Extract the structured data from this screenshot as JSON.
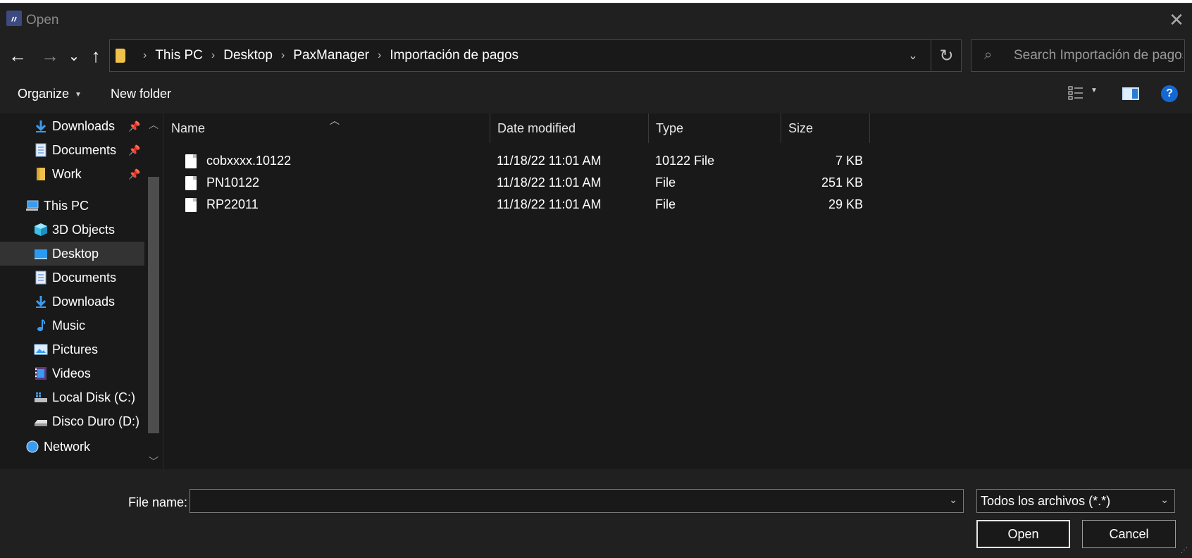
{
  "window": {
    "title": "Open",
    "close_glyph": "✕"
  },
  "nav_buttons": {
    "back": "←",
    "forward": "→",
    "recent": "⌄",
    "up": "↑"
  },
  "address": {
    "crumbs": [
      "This PC",
      "Desktop",
      "PaxManager",
      "Importación de pagos"
    ],
    "separator": "›",
    "refresh_glyph": "↻",
    "dropdown_glyph": "⌄"
  },
  "search": {
    "placeholder": "Search Importación de pagos",
    "icon": "⌕"
  },
  "toolbar": {
    "organize_label": "Organize",
    "new_folder_label": "New folder",
    "help_label": "?"
  },
  "sidebar": {
    "quick_access": [
      {
        "label": "Downloads",
        "icon": "download-arrow-icon",
        "pinned": true
      },
      {
        "label": "Documents",
        "icon": "document-icon",
        "pinned": true
      },
      {
        "label": "Work",
        "icon": "folder-icon",
        "pinned": true
      }
    ],
    "this_pc_label": "This PC",
    "this_pc_items": [
      {
        "label": "3D Objects",
        "icon": "cube-icon"
      },
      {
        "label": "Desktop",
        "icon": "desktop-icon",
        "selected": true
      },
      {
        "label": "Documents",
        "icon": "document-icon"
      },
      {
        "label": "Downloads",
        "icon": "download-arrow-icon"
      },
      {
        "label": "Music",
        "icon": "music-note-icon"
      },
      {
        "label": "Pictures",
        "icon": "picture-icon"
      },
      {
        "label": "Videos",
        "icon": "video-icon"
      },
      {
        "label": "Local Disk (C:)",
        "icon": "system-drive-icon"
      },
      {
        "label": "Disco Duro (D:)",
        "icon": "drive-icon"
      }
    ],
    "network_label": "Network"
  },
  "columns": {
    "name": "Name",
    "date": "Date modified",
    "type": "Type",
    "size": "Size"
  },
  "files": [
    {
      "name": "cobxxxx.10122",
      "date": "11/18/22 11:01 AM",
      "type": "10122 File",
      "size": "7 KB"
    },
    {
      "name": "PN10122",
      "date": "11/18/22 11:01 AM",
      "type": "File",
      "size": "251 KB"
    },
    {
      "name": "RP22011",
      "date": "11/18/22 11:01 AM",
      "type": "File",
      "size": "29 KB"
    }
  ],
  "footer": {
    "file_name_label": "File name:",
    "file_name_value": "",
    "file_type_value": "Todos los archivos (*.*)",
    "open_label": "Open",
    "cancel_label": "Cancel"
  },
  "colors": {
    "background": "#191919",
    "panel": "#202020",
    "selected": "#333333",
    "accent": "#1668d1"
  }
}
